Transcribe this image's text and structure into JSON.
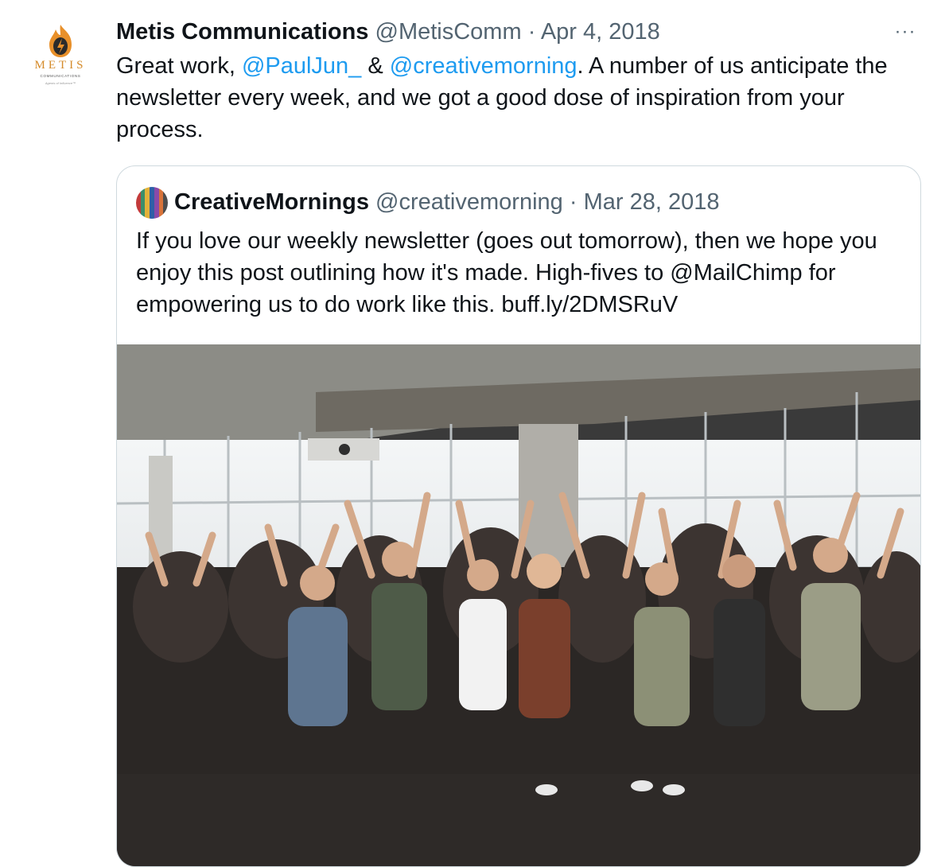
{
  "tweet": {
    "author": {
      "display_name": "Metis Communications",
      "handle": "@MetisComm",
      "date": "Apr 4, 2018",
      "separator": "·",
      "avatar_brand": "METIS",
      "avatar_sub": "COMMUNICATIONS",
      "avatar_tagline": "Agents of Influence™",
      "avatar_colors": {
        "flame": "#e8902a",
        "flame_inner": "#2b2b2b",
        "brand": "#d58b2a"
      }
    },
    "more_label": "···",
    "text": {
      "prefix": "Great work, ",
      "mention1": "@PaulJun_",
      "middle": " & ",
      "mention2": "@creativemorning",
      "suffix": ". A number of us anticipate the newsletter every week, and we got a good dose of inspiration from your process."
    },
    "mention_color": "#1d9bf0"
  },
  "quoted": {
    "display_name": "CreativeMornings",
    "handle": "@creativemorning",
    "date": "Mar 28, 2018",
    "separator": "·",
    "text": "If you love our weekly newsletter (goes out tomorrow), then we hope you enjoy this post outlining how it's made. High-fives to @MailChimp for empowering us to do work like this. buff.ly/2DMSRuV",
    "avatar_stripes": [
      "#c23b3b",
      "#3a8f6b",
      "#e2b23a",
      "#2f5fa6",
      "#8a4aa8",
      "#d8733a",
      "#4d4d4d"
    ],
    "image_icon": "photo-crowd-raising-hands"
  }
}
